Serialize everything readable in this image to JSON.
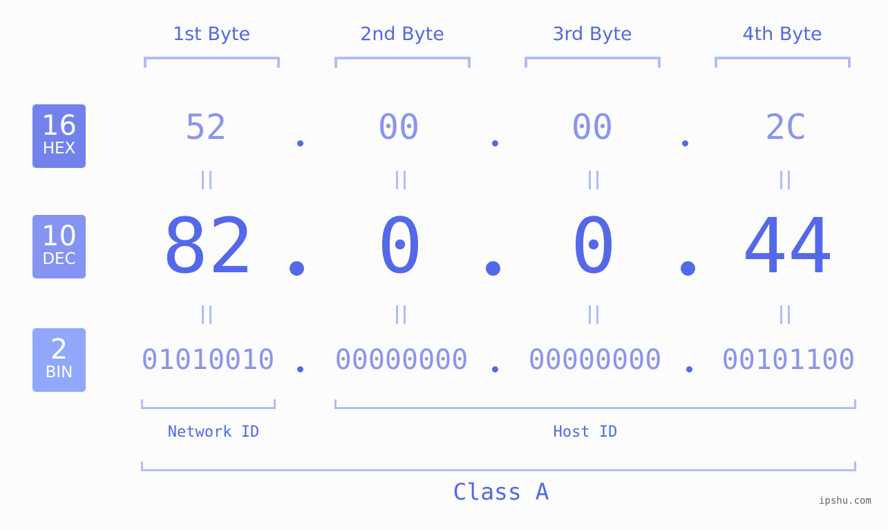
{
  "byte_headers": [
    "1st Byte",
    "2nd Byte",
    "3rd Byte",
    "4th Byte"
  ],
  "badges": {
    "hex": {
      "base": "16",
      "label": "HEX",
      "color": "#7282ec"
    },
    "dec": {
      "base": "10",
      "label": "DEC",
      "color": "#8593f2"
    },
    "bin": {
      "base": "2",
      "label": "BIN",
      "color": "#90a7fa"
    }
  },
  "hex": [
    "52",
    "00",
    "00",
    "2C"
  ],
  "dec": [
    "82",
    "0",
    "0",
    "44"
  ],
  "bin": [
    "01010010",
    "00000000",
    "00000000",
    "00101100"
  ],
  "separator": ".",
  "network_id_label": "Network ID",
  "host_id_label": "Host ID",
  "class_label": "Class A",
  "watermark": "ipshu.com",
  "colors": {
    "accent": "#5468ea",
    "light_accent": "#8a95ec",
    "bracket": "#b3bcf7",
    "background": "#fbfcfb"
  }
}
